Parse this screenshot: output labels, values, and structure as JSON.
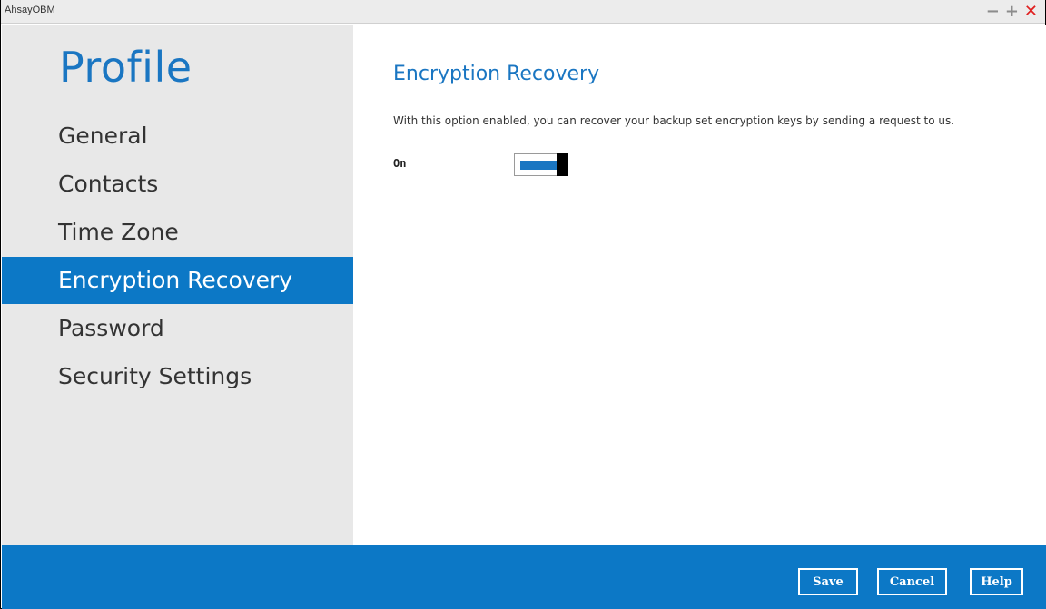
{
  "app": {
    "title": "AhsayOBM"
  },
  "window_controls": {
    "minimize": "−",
    "maximize": "+",
    "close": "✕"
  },
  "sidebar": {
    "heading": "Profile",
    "items": [
      {
        "label": "General",
        "active": false
      },
      {
        "label": "Contacts",
        "active": false
      },
      {
        "label": "Time Zone",
        "active": false
      },
      {
        "label": "Encryption Recovery",
        "active": true
      },
      {
        "label": "Password",
        "active": false
      },
      {
        "label": "Security Settings",
        "active": false
      }
    ]
  },
  "main": {
    "title": "Encryption Recovery",
    "description": "With this option enabled, you can recover your backup set encryption keys by sending a request to us.",
    "toggle": {
      "label": "On",
      "state": "on"
    }
  },
  "footer": {
    "save": "Save",
    "cancel": "Cancel",
    "help": "Help"
  },
  "colors": {
    "accent": "#0c78c6",
    "heading": "#1a76c2",
    "sidebar_bg": "#e8e8e8",
    "close": "#e02020"
  }
}
